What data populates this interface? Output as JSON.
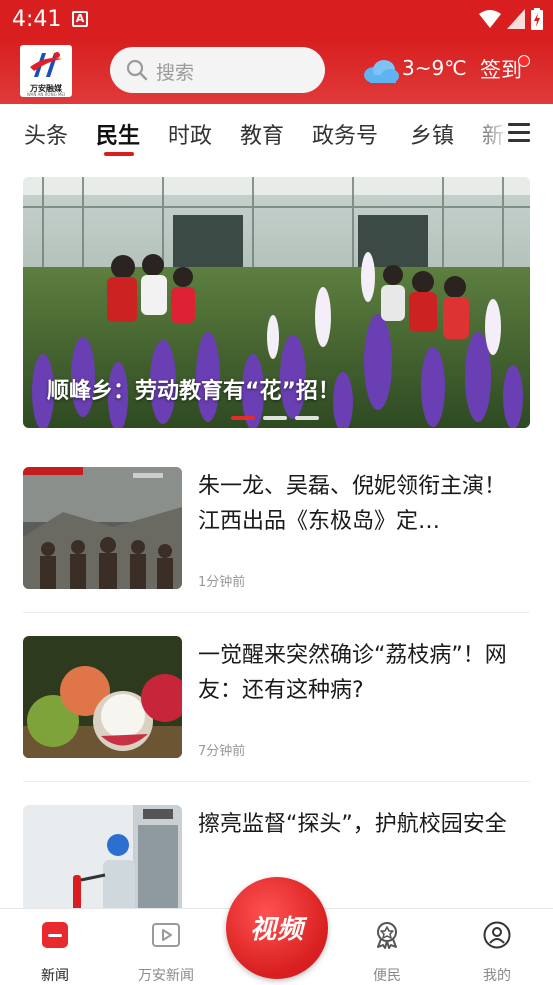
{
  "status_bar": {
    "time": "4:41",
    "notification_icon": "A"
  },
  "header": {
    "logo_text": "万安融媒",
    "logo_subtext": "WAN AN RONG MEI",
    "search_placeholder": "搜索",
    "temperature": "3~9℃",
    "signin_label": "签到",
    "weather_icon": "cloud-icon"
  },
  "tabs": [
    {
      "label": "头条",
      "active": false
    },
    {
      "label": "民生",
      "active": true
    },
    {
      "label": "时政",
      "active": false
    },
    {
      "label": "教育",
      "active": false
    },
    {
      "label": "政务号",
      "active": false
    },
    {
      "label": "乡镇",
      "active": false
    },
    {
      "label": "新",
      "active": false
    }
  ],
  "banner": {
    "caption": "顺峰乡：劳动教育有“花”招！",
    "slide_count": 3,
    "active_slide": 1
  },
  "news": [
    {
      "title": "朱一龙、吴磊、倪妮领衔主演！江西出品《东极岛》定…",
      "time": "1分钟前"
    },
    {
      "title": "一觉醒来突然确诊“荔枝病”！网友：还有这种病?",
      "time": "7分钟前"
    },
    {
      "title": "擦亮监督“探头”，护航校园安全",
      "time": ""
    }
  ],
  "bottom_nav": [
    {
      "label": "新闻",
      "icon": "news-icon",
      "active": true
    },
    {
      "label": "万安新闻",
      "icon": "video-play-icon",
      "active": false
    },
    {
      "label": "视频",
      "icon": "video-button",
      "active": false
    },
    {
      "label": "便民",
      "icon": "badge-icon",
      "active": false
    },
    {
      "label": "我的",
      "icon": "user-icon",
      "active": false
    }
  ],
  "colors": {
    "brand_red": "#d81e1e",
    "text_dark": "#1a1a1a",
    "text_muted": "#999999"
  }
}
